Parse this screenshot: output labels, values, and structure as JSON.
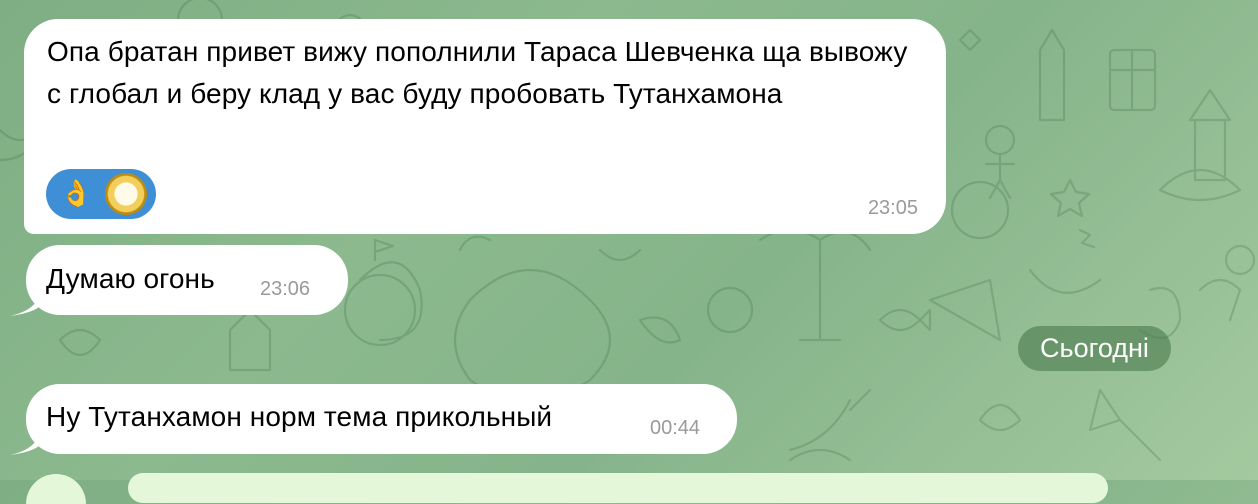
{
  "messages": [
    {
      "text": "Опа братан привет вижу пополнили Тараса Шевченка ща вывожу с глобал и беру клад у вас буду пробовать Тутанхамона",
      "time": "23:05",
      "reaction": {
        "emoji": "👌",
        "emoji_icon": "ok-hand-icon",
        "avatar_icon": "gold-ring-avatar-icon"
      }
    },
    {
      "text": "Думаю огонь",
      "time": "23:06"
    },
    {
      "text": "Ну Тутанхамон норм тема прикольный",
      "time": "00:44"
    }
  ],
  "date_separator": "Сьогодні",
  "colors": {
    "wallpaper": "#86b48a",
    "incoming_bubble": "#ffffff",
    "outgoing_bubble": "#e4f7d9",
    "reaction_pill": "#3e8fd6",
    "time_text": "#9a9a9a",
    "date_badge": "#4c7a4e"
  }
}
